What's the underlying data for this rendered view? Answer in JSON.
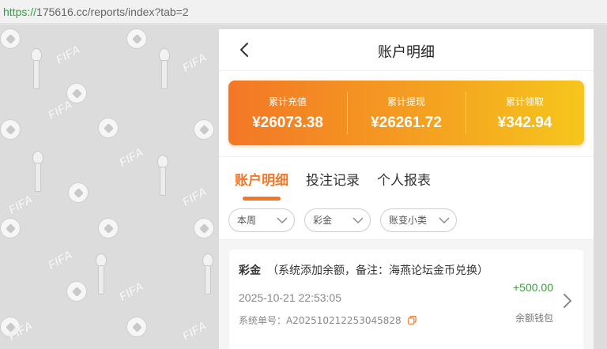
{
  "browser": {
    "url_scheme": "https://",
    "url_rest": "175616.cc/reports/index?tab=2"
  },
  "header": {
    "title": "账户明细",
    "back_icon": "chevron-left-icon"
  },
  "summary": [
    {
      "label": "累计充值",
      "value": "¥26073.38"
    },
    {
      "label": "累计提现",
      "value": "¥26261.72"
    },
    {
      "label": "累计领取",
      "value": "¥342.94"
    }
  ],
  "tabs": [
    {
      "label": "账户明细",
      "active": true
    },
    {
      "label": "投注记录",
      "active": false
    },
    {
      "label": "个人报表",
      "active": false
    }
  ],
  "filters": [
    {
      "label": "本周"
    },
    {
      "label": "彩金"
    },
    {
      "label": "账变小类"
    }
  ],
  "record": {
    "type": "彩金",
    "description": "（系统添加余额，备注：海燕论坛金币兑换）",
    "amount": "+500.00",
    "time": "2025-10-21 22:53:05",
    "wallet": "余额钱包",
    "serial": "系统单号：A202510212253045828"
  },
  "colors": {
    "accent": "#f37726",
    "gradient_end": "#f6c61c",
    "positive": "#3a9c3a"
  }
}
